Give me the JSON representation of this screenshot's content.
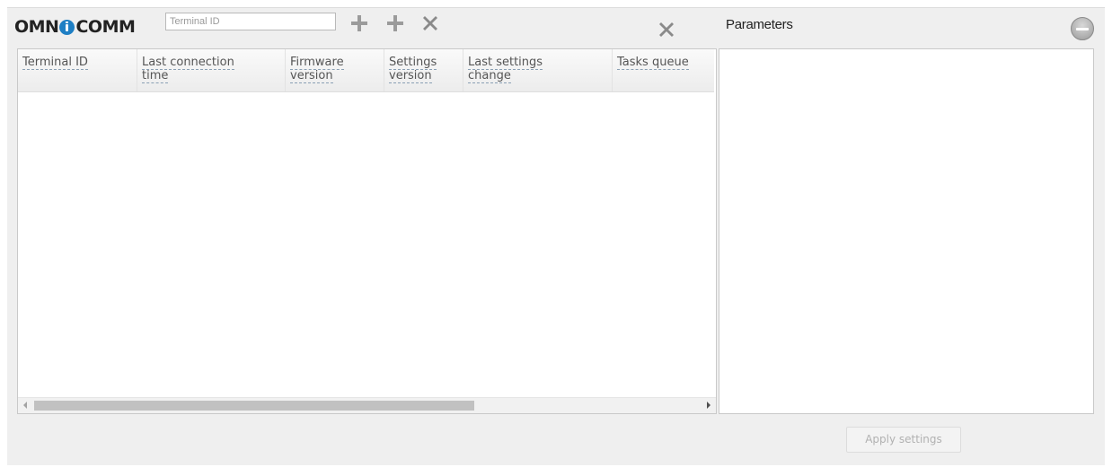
{
  "header": {
    "logo_left": "OMN",
    "logo_right": "COMM",
    "search_placeholder": "Terminal ID",
    "icons": [
      "add-icon",
      "add-icon",
      "delete-icon",
      "close-icon"
    ]
  },
  "grid": {
    "columns": [
      {
        "line1": "Terminal ID",
        "line2": ""
      },
      {
        "line1": "Last connection",
        "line2": "time"
      },
      {
        "line1": "Firmware",
        "line2": "version"
      },
      {
        "line1": "Settings",
        "line2": "version"
      },
      {
        "line1": "Last settings",
        "line2": "change"
      },
      {
        "line1": "Tasks queue",
        "line2": ""
      }
    ],
    "rows": []
  },
  "parameters": {
    "title": "Parameters",
    "apply_label": "Apply settings",
    "apply_enabled": false
  },
  "colors": {
    "brand_blue": "#1e7fc4",
    "icon_gray": "#8a8a8a",
    "panel_bg": "#efefef"
  }
}
